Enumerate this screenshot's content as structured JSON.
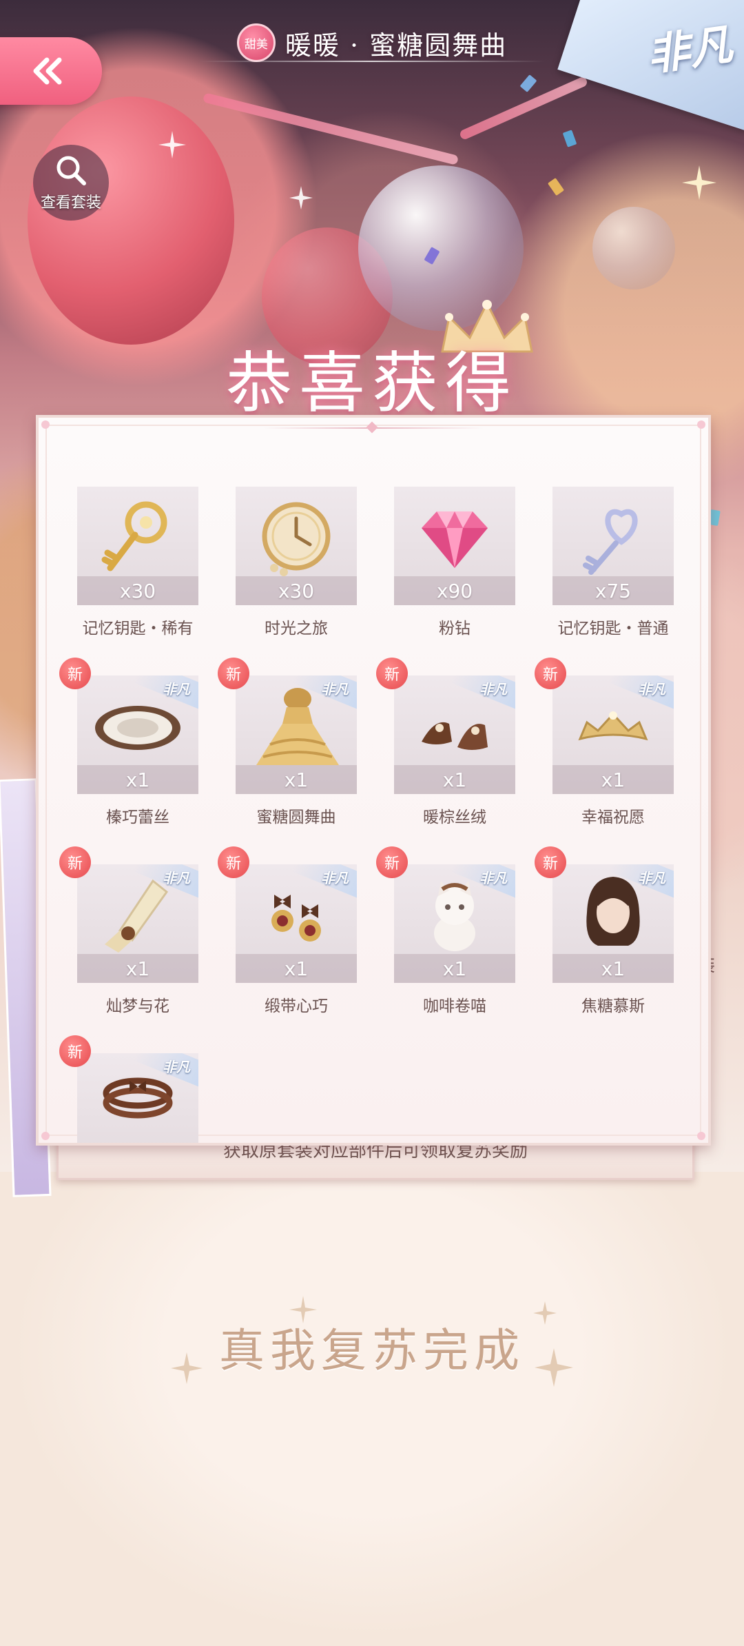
{
  "header": {
    "badge": "甜美",
    "title": "暖暖 · 蜜糖圆舞曲",
    "corner_tag": "非凡"
  },
  "view_set_label": "查看套装",
  "congrats_title": "恭喜获得",
  "side_peek_label": "装",
  "panel_notice": "获取原套装对应部件后可领取复苏奖励",
  "new_badge": "新",
  "rare_tag": "非凡",
  "rewards": [
    {
      "name": "记忆钥匙・稀有",
      "qty": "x30",
      "icon": "gold-key-icon"
    },
    {
      "name": "时光之旅",
      "qty": "x30",
      "icon": "clock-icon"
    },
    {
      "name": "粉钻",
      "qty": "x90",
      "icon": "pink-diamond-icon"
    },
    {
      "name": "记忆钥匙・普通",
      "qty": "x75",
      "icon": "silver-key-icon"
    },
    {
      "name": "榛巧蕾丝",
      "qty": "x1",
      "icon": "lace-doily-icon",
      "new": true,
      "rare": true
    },
    {
      "name": "蜜糖圆舞曲",
      "qty": "x1",
      "icon": "gown-icon",
      "new": true,
      "rare": true
    },
    {
      "name": "暖棕丝绒",
      "qty": "x1",
      "icon": "shoes-icon",
      "new": true,
      "rare": true
    },
    {
      "name": "幸福祝愿",
      "qty": "x1",
      "icon": "tiara-icon",
      "new": true,
      "rare": true
    },
    {
      "name": "灿梦与花",
      "qty": "x1",
      "icon": "gloves-icon",
      "new": true,
      "rare": true
    },
    {
      "name": "缎带心巧",
      "qty": "x1",
      "icon": "earrings-icon",
      "new": true,
      "rare": true
    },
    {
      "name": "咖啡卷喵",
      "qty": "x1",
      "icon": "cat-icon",
      "new": true,
      "rare": true
    },
    {
      "name": "焦糖慕斯",
      "qty": "x1",
      "icon": "hairstyle-icon",
      "new": true,
      "rare": true
    },
    {
      "name": "",
      "qty": "",
      "icon": "bracelet-icon",
      "new": true,
      "rare": true
    }
  ],
  "completion_text": "真我复苏完成",
  "colors": {
    "accent_pink": "#f0607f",
    "new_badge_red": "#e6494d",
    "text_brown": "#6a5250",
    "completion_gold": "#c9a58c"
  }
}
